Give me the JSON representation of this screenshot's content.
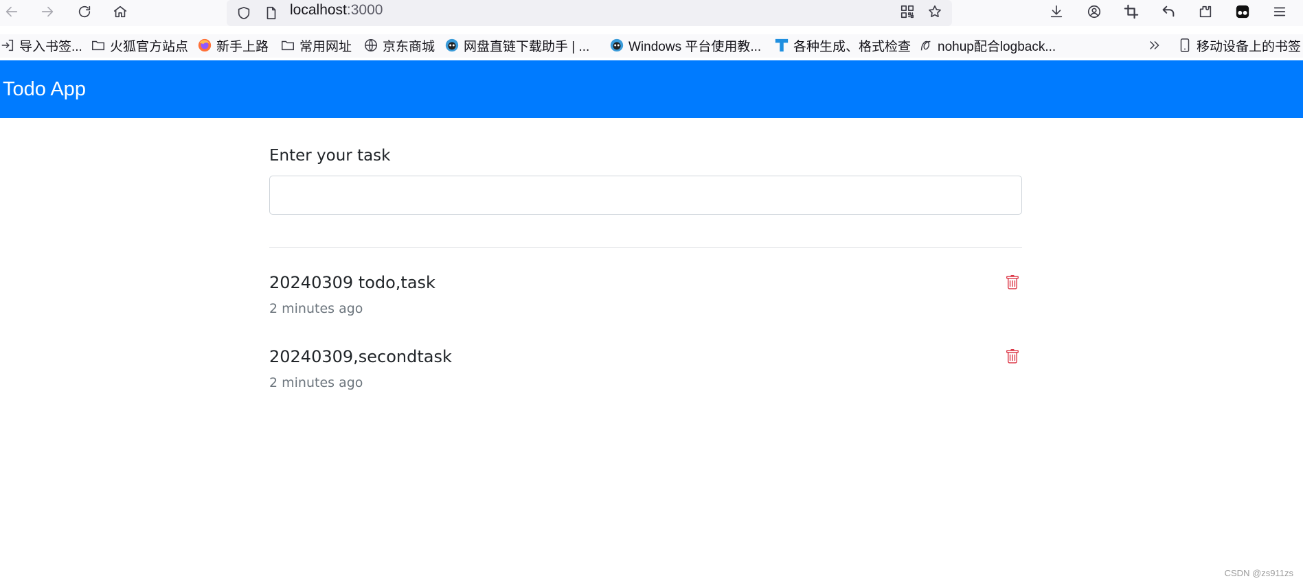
{
  "browser": {
    "url_host": "localhost",
    "url_port": ":3000",
    "bookmarks": [
      {
        "label": "导入书签...",
        "icon": "import-icon"
      },
      {
        "label": "火狐官方站点",
        "icon": "folder-icon"
      },
      {
        "label": "新手上路",
        "icon": "firefox-icon"
      },
      {
        "label": "常用网址",
        "icon": "folder-icon"
      },
      {
        "label": "京东商城",
        "icon": "globe-icon"
      },
      {
        "label": "网盘直链下载助手 | ...",
        "icon": "avatar-icon"
      },
      {
        "label": "Windows 平台使用教...",
        "icon": "avatar-icon"
      },
      {
        "label": "各种生成、格式检查",
        "icon": "t-logo-icon"
      },
      {
        "label": "nohup配合logback...",
        "icon": "link-icon"
      }
    ],
    "mobile_bookmarks_label": "移动设备上的书签"
  },
  "app": {
    "brand": "Todo App",
    "input_label": "Enter your task",
    "input_value": "",
    "todos": [
      {
        "text": "20240309 todo,task",
        "time": "2 minutes ago"
      },
      {
        "text": "20240309,secondtask",
        "time": "2 minutes ago"
      }
    ]
  },
  "watermark": "CSDN @zs911zs",
  "colors": {
    "navbar": "#007bff",
    "delete_icon": "#dc3545",
    "muted_text": "#6c757d"
  }
}
